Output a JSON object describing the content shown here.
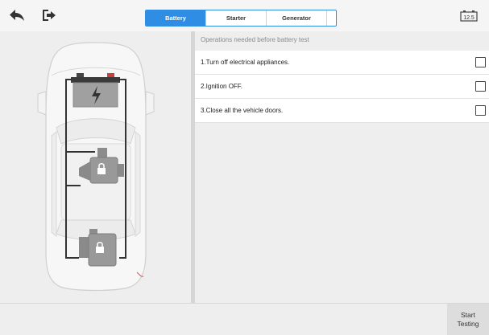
{
  "toolbar": {
    "back_icon": "back-arrow-icon",
    "exit_icon": "exit-icon",
    "voltage": "12.5",
    "accent_color": "#2f8ee3"
  },
  "tabs": [
    {
      "label": "Battery",
      "active": true
    },
    {
      "label": "Starter",
      "active": false
    },
    {
      "label": "Generator",
      "active": false
    }
  ],
  "checklist": {
    "header": "Operations needed before battery test",
    "items": [
      {
        "label": "1.Turn off electrical appliances.",
        "checked": false
      },
      {
        "label": "2.Ignition OFF.",
        "checked": false
      },
      {
        "label": "3.Close all the vehicle doors.",
        "checked": false
      }
    ]
  },
  "footer": {
    "start_label_line1": "Start",
    "start_label_line2": "Testing"
  }
}
